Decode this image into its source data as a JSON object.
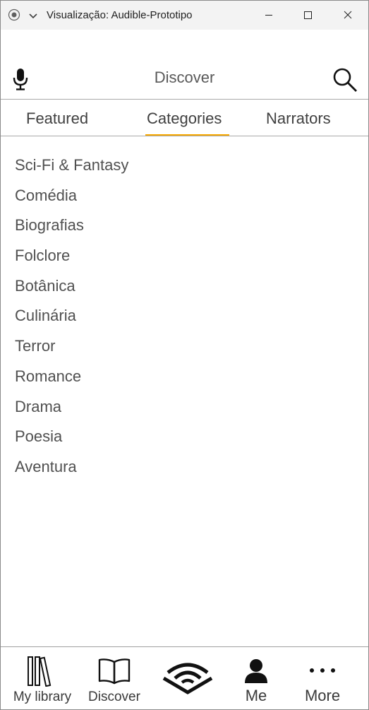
{
  "window": {
    "title": "Visualização: Audible-Prototipo"
  },
  "header": {
    "title": "Discover"
  },
  "tabs": [
    {
      "label": "Featured",
      "selected": false
    },
    {
      "label": "Categories",
      "selected": true
    },
    {
      "label": "Narrators",
      "selected": false
    }
  ],
  "categories": [
    "Sci-Fi & Fantasy",
    "Comédia",
    "Biografias",
    "Folclore",
    "Botânica",
    "Culinária",
    "Terror",
    "Romance",
    "Drama",
    "Poesia",
    "Aventura"
  ],
  "bottom_nav": {
    "library": "My library",
    "discover": "Discover",
    "me": "Me",
    "more": "More"
  },
  "colors": {
    "accent": "#f7a800",
    "text": "#505050",
    "titlebar": "#f3f3f3"
  },
  "icons": [
    "record-icon",
    "chevron-down-icon",
    "minimize-icon",
    "maximize-icon",
    "close-icon",
    "microphone-icon",
    "search-icon",
    "library-icon",
    "book-icon",
    "audible-logo-icon",
    "person-icon",
    "more-dots-icon"
  ]
}
